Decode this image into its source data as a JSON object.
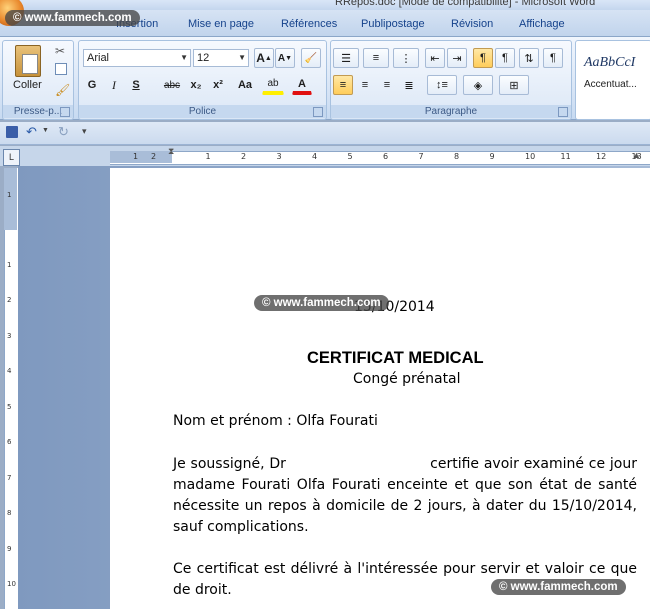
{
  "window": {
    "title": "RRepos.doc [Mode de compatibilité] - Microsoft Word"
  },
  "tabs": [
    "Insertion",
    "Mise en page",
    "Références",
    "Publipostage",
    "Révision",
    "Affichage"
  ],
  "ribbon": {
    "clipboard": {
      "paste_label": "Coller",
      "group_label": "Presse-p..."
    },
    "font": {
      "name": "Arial",
      "size": "12",
      "bold": "G",
      "italic": "I",
      "strike": "abc",
      "underline": "S",
      "subscript": "x₂",
      "superscript": "x²",
      "case": "Aa",
      "highlight": "ab",
      "font_color": "A",
      "grow": "A",
      "shrink": "A",
      "group_label": "Police"
    },
    "paragraph": {
      "group_label": "Paragraphe"
    },
    "styles": {
      "preview": "AaBbCcI",
      "name": "Accentuat..."
    }
  },
  "ruler": {
    "h_ticks": [
      "1",
      "2",
      "1",
      "2",
      "3",
      "4",
      "5",
      "6",
      "7",
      "8",
      "9",
      "10",
      "11",
      "12",
      "13"
    ],
    "v_ticks": [
      "1",
      "1",
      "2",
      "3",
      "4",
      "5",
      "6",
      "7",
      "8",
      "9",
      "10"
    ]
  },
  "document": {
    "date": "15/10/2014",
    "title": "CERTIFICAT MEDICAL",
    "subtitle": "Congé prénatal",
    "name_line": "Nom et prénom : Olfa Fourati",
    "para1": "Je soussigné, Dr                              certifie avoir examiné ce jour madame Fourati Olfa Fourati enceinte et que son état de santé nécessite un repos à domicile de 2 jours, à dater du 15/10/2014, sauf complications.",
    "para2": "Ce certificat est délivré à l'intéressée pour servir et valoir ce que de droit."
  },
  "watermark": {
    "text": "© www.fammech.com"
  }
}
